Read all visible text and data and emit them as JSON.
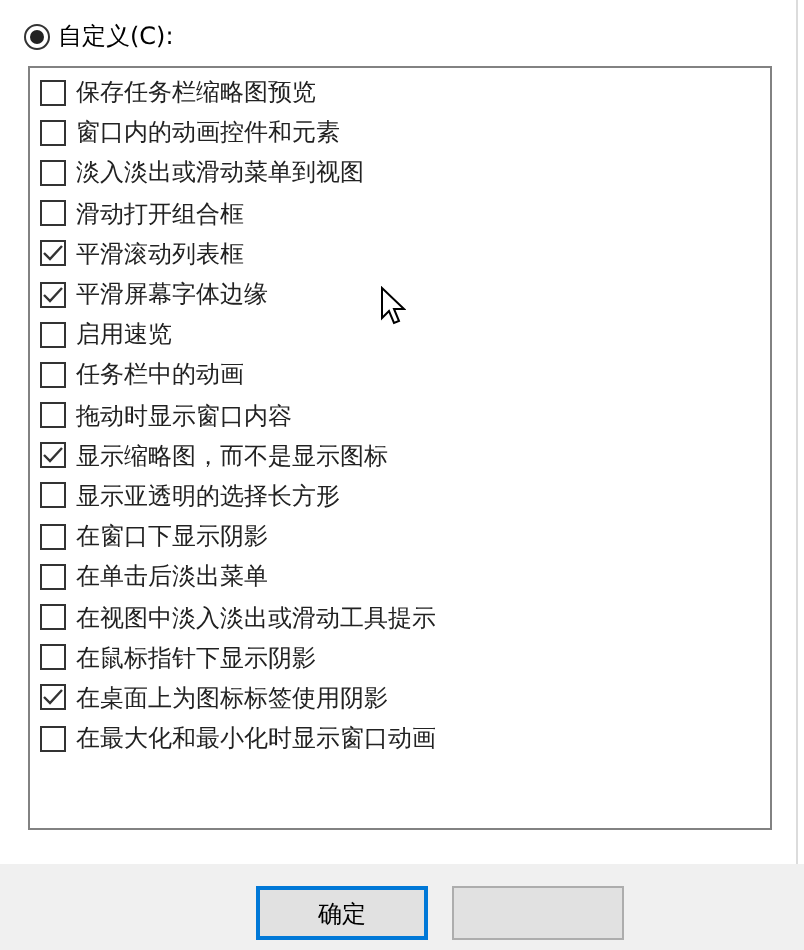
{
  "custom_option": {
    "label": "自定义(C):",
    "selected": true
  },
  "options": [
    {
      "label": "保存任务栏缩略图预览",
      "checked": false
    },
    {
      "label": "窗口内的动画控件和元素",
      "checked": false
    },
    {
      "label": "淡入淡出或滑动菜单到视图",
      "checked": false
    },
    {
      "label": "滑动打开组合框",
      "checked": false
    },
    {
      "label": "平滑滚动列表框",
      "checked": true
    },
    {
      "label": "平滑屏幕字体边缘",
      "checked": true
    },
    {
      "label": "启用速览",
      "checked": false
    },
    {
      "label": "任务栏中的动画",
      "checked": false
    },
    {
      "label": "拖动时显示窗口内容",
      "checked": false
    },
    {
      "label": "显示缩略图，而不是显示图标",
      "checked": true
    },
    {
      "label": "显示亚透明的选择长方形",
      "checked": false
    },
    {
      "label": "在窗口下显示阴影",
      "checked": false
    },
    {
      "label": "在单击后淡出菜单",
      "checked": false
    },
    {
      "label": "在视图中淡入淡出或滑动工具提示",
      "checked": false
    },
    {
      "label": "在鼠标指针下显示阴影",
      "checked": false
    },
    {
      "label": "在桌面上为图标标签使用阴影",
      "checked": true
    },
    {
      "label": "在最大化和最小化时显示窗口动画",
      "checked": false
    }
  ],
  "buttons": [
    {
      "label": "确定",
      "default": true
    },
    {
      "default": false
    }
  ]
}
